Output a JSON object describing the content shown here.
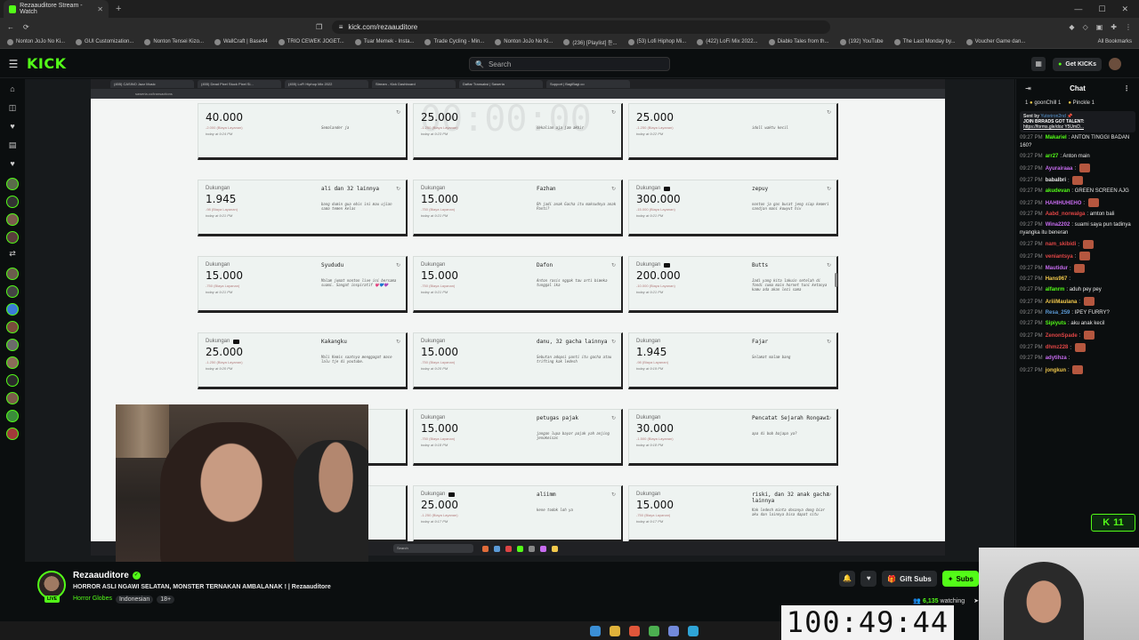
{
  "browser": {
    "tab_title": "Rezaauditore Stream - Watch",
    "url": "kick.com/rezaauditore",
    "bookmarks": [
      "Nonton JoJo No Ki...",
      "GUI Customization...",
      "Nonton Tensei Kizo...",
      "WallCraft | Base44",
      "TRIO CEWEK JOGET...",
      "Tuar Memek - Insta...",
      "Trade Cycling - Min...",
      "Nonton JoJo No Ki...",
      "(236) [Playlist] 듣...",
      "(53) Lofi Hiphop Mi...",
      "(422) LoFi Mix 2022...",
      "Diablo Tales from th...",
      "(192) YouTube",
      "The Last Monday by...",
      "Voucher Game dan..."
    ],
    "all_bookmarks": "All Bookmarks"
  },
  "header": {
    "logo": "KICK",
    "search_placeholder": "Search",
    "get_kicks": "Get KICKs"
  },
  "inner_browser": {
    "tabs": [
      "(455) CASINO Jazz Music",
      "(455) Dead Pixel Stuck Pixel Si...",
      "(455) LoFi Hiphop Mix 2022",
      "Stream - Kick Dashboard",
      "Daftar Transaksi | Saweria",
      "Support | BagiBagi.co"
    ],
    "url": "saweria.co/transactions",
    "faded_timer": "00:00:00",
    "search": "Search",
    "donations": [
      {
        "label": "",
        "amount": "40.000",
        "fee": "-2.000 (Biaya Layanan)",
        "time": "today at 9:24 PM",
        "name": "",
        "msg": "Semalander ja",
        "yt": false
      },
      {
        "label": "",
        "amount": "25.000",
        "fee": "-1.250 (Biaya Layanan)",
        "time": "today at 9:23 PM",
        "name": "",
        "msg": "sekalian aja jam akhir",
        "yt": false
      },
      {
        "label": "",
        "amount": "25.000",
        "fee": "-1.250 (Biaya Layanan)",
        "time": "today at 9:22 PM",
        "name": "",
        "msg": "idoll waktu kecil",
        "yt": false
      },
      {
        "label": "Dukungan",
        "amount": "1.945",
        "fee": "-98 (Biaya Layanan)",
        "time": "today at 9:21 PM",
        "name": "ali dan 32 lainnya",
        "msg": "bang dumin gua ebis ini mau ujian sama temen kelas",
        "yt": false
      },
      {
        "label": "Dukungan",
        "amount": "15.000",
        "fee": "-750 (Biaya Layanan)",
        "time": "today at 9:21 PM",
        "name": "Fazhan",
        "msg": "Oh jadi anak Gacha itu maksudnya anak Panti?",
        "yt": false
      },
      {
        "label": "Dukungan",
        "amount": "300.000",
        "fee": "-15.000 (Biaya Layanan)",
        "time": "today at 9:21 PM",
        "name": "zepuy",
        "msg": "nonton ja gas bucat jeng siap kemeri sandjan mani kowyut hiv",
        "yt": true
      },
      {
        "label": "Dukungan",
        "amount": "15.000",
        "fee": "-750 (Biaya Layanan)",
        "time": "today at 9:21 PM",
        "name": "Syududu",
        "msg": "Malam jumat nonton live ini bersama suami. Sangat inspiratif 💗💙💜",
        "yt": false
      },
      {
        "label": "Dukungan",
        "amount": "15.000",
        "fee": "-750 (Biaya Layanan)",
        "time": "today at 9:21 PM",
        "name": "Dafon",
        "msg": "Anton rasis nggak tau arti bimeka tunggal ika",
        "yt": false
      },
      {
        "label": "Dukungan",
        "amount": "200.000",
        "fee": "-10.000 (Biaya Layanan)",
        "time": "today at 9:21 PM",
        "name": "Butts",
        "msg": "Jadi yang kita lakuin setelah di fondi cuma main hornet tuni ketanya kamu ada akan lezi sama",
        "yt": true
      },
      {
        "label": "Dukungan",
        "amount": "25.000",
        "fee": "-1.250 (Biaya Layanan)",
        "time": "today at 9:20 PM",
        "name": "Kakangku",
        "msg": "Mali Kemis saatnya menggagat mace lalu tje di youtube.",
        "yt": true
      },
      {
        "label": "Dukungan",
        "amount": "15.000",
        "fee": "-750 (Biaya Layanan)",
        "time": "today at 9:20 PM",
        "name": "danu, 32 gacha lainnya",
        "msg": "Sebutan adopsi panti itu gacha atau trifting kak ledesh",
        "yt": false
      },
      {
        "label": "Dukungan",
        "amount": "1.945",
        "fee": "-98 (Biaya Layanan)",
        "time": "today at 9:19 PM",
        "name": "Fajar",
        "msg": "Selamat malam bang",
        "yt": false
      },
      {
        "label": "",
        "amount": "",
        "fee": "",
        "time": "",
        "name": "",
        "msg": "",
        "yt": false
      },
      {
        "label": "Dukungan",
        "amount": "15.000",
        "fee": "-750 (Biaya Layanan)",
        "time": "today at 9:18 PM",
        "name": "petugas pajak",
        "msg": "jangan lupa bayar pajak yah anjing jenokeisas",
        "yt": false
      },
      {
        "label": "Dukungan",
        "amount": "30.000",
        "fee": "-1.500 (Biaya Layanan)",
        "time": "today at 9:18 PM",
        "name": "Pencatat Sejarah Rongawi",
        "msg": "apa di bob bajapa ya?",
        "yt": false
      },
      {
        "label": "",
        "amount": "",
        "fee": "",
        "time": "",
        "name": "",
        "msg": "",
        "yt": false
      },
      {
        "label": "Dukungan",
        "amount": "25.000",
        "fee": "-1.250 (Biaya Layanan)",
        "time": "today at 9:17 PM",
        "name": "aliimm",
        "msg": "kene todok loh ya",
        "yt": true
      },
      {
        "label": "Dukungan",
        "amount": "15.000",
        "fee": "-750 (Biaya Layanan)",
        "time": "today at 9:17 PM",
        "name": "riski, dan 32 anak gacha lainnya",
        "msg": "Kak ledesh minta dosanya dong biar aku dan lainnya bisa dapat situ",
        "yt": false
      }
    ]
  },
  "stream": {
    "streamer": "Rezaauditore",
    "title": "HORROR ASLI NGAWI SELATAN, MONSTER TERNAKAN AMBALANAK ! | Rezaauditore",
    "category": "Horror Globes",
    "tags": [
      "Indonesian",
      "18+"
    ],
    "gift_subs": "Gift Subs",
    "subscribe": "Subs",
    "watching_count": "6,135",
    "watching_label": "watching"
  },
  "chat": {
    "title": "Chat",
    "leaders": [
      {
        "rank": "1",
        "name": "goonChill",
        "count": "1"
      },
      {
        "rank": "",
        "name": "Pinckle",
        "count": "1"
      }
    ],
    "pinned": {
      "sent_by": "Sent by",
      "user": "Yutoriron2nd",
      "title": "JOIN BRRADS GOT TALENT:",
      "link": "https://forms.gle/doz Y5UmD..."
    },
    "messages": [
      {
        "time": "09:27 PM",
        "user": "Makariel",
        "color": "#53fc18",
        "text": "ANTON TINGGI BADAN 160?",
        "emote": false
      },
      {
        "time": "09:27 PM",
        "user": "arr27",
        "color": "#53fc18",
        "text": "Anton main",
        "emote": false
      },
      {
        "time": "09:27 PM",
        "user": "Ayurairaaa",
        "color": "#c86cf1",
        "text": "",
        "emote": true
      },
      {
        "time": "09:27 PM",
        "user": "babalbri",
        "color": "#e8e8e8",
        "text": "",
        "emote": true
      },
      {
        "time": "09:27 PM",
        "user": "akudevan",
        "color": "#53fc18",
        "text": "GREEN SCREEN AJG",
        "emote": false
      },
      {
        "time": "09:27 PM",
        "user": "HAHIHUHEHO",
        "color": "#c86cf1",
        "text": "",
        "emote": true
      },
      {
        "time": "09:27 PM",
        "user": "Aabd_norwalga",
        "color": "#e04545",
        "text": "amton bali",
        "emote": false
      },
      {
        "time": "09:27 PM",
        "user": "Wina2202",
        "color": "#c86cf1",
        "text": "suami saya pun tadinya nyangka itu beneran",
        "emote": false
      },
      {
        "time": "09:27 PM",
        "user": "nam_skibidi",
        "color": "#e04545",
        "text": "",
        "emote": true
      },
      {
        "time": "09:27 PM",
        "user": "veniantsya",
        "color": "#e04545",
        "text": "",
        "emote": true
      },
      {
        "time": "09:27 PM",
        "user": "Mautidur",
        "color": "#c86cf1",
        "text": "",
        "emote": true
      },
      {
        "time": "09:27 PM",
        "user": "Hans967",
        "color": "#f2c94c",
        "text": "",
        "emote": false
      },
      {
        "time": "09:27 PM",
        "user": "alfanrm",
        "color": "#53fc18",
        "text": "aduh pey pey",
        "emote": false
      },
      {
        "time": "09:27 PM",
        "user": "AriiiMaulana",
        "color": "#f2c94c",
        "text": "",
        "emote": true
      },
      {
        "time": "09:27 PM",
        "user": "Resa_259",
        "color": "#5b9ad6",
        "text": "IPEY FURRY?",
        "emote": false
      },
      {
        "time": "09:27 PM",
        "user": "Sipiyuts",
        "color": "#53fc18",
        "text": "aku anak kecil",
        "emote": false
      },
      {
        "time": "09:27 PM",
        "user": "ZenonSpade",
        "color": "#e04545",
        "text": "",
        "emote": true
      },
      {
        "time": "09:27 PM",
        "user": "dhmz228",
        "color": "#e04545",
        "text": "",
        "emote": true
      },
      {
        "time": "09:27 PM",
        "user": "adytihza",
        "color": "#c86cf1",
        "text": "",
        "emote": false
      },
      {
        "time": "09:27 PM",
        "user": "jongkun",
        "color": "#f2c94c",
        "text": "",
        "emote": true
      }
    ],
    "kick_badge": "11"
  },
  "timer": "100:49:44"
}
